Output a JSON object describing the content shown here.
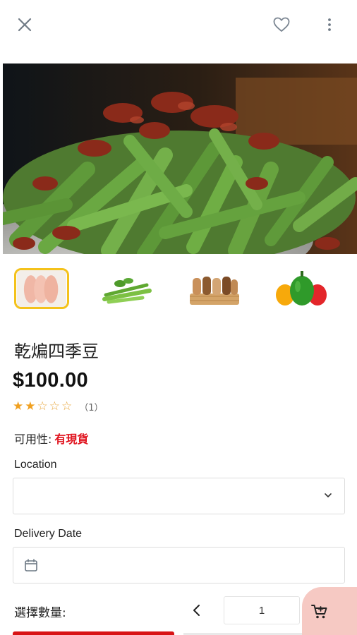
{
  "header": {
    "close_icon": "close-icon",
    "favorite_icon": "heart-outline-icon",
    "more_icon": "more-vertical-icon"
  },
  "gallery": {
    "main_image": "stir-fried green beans with dried chili",
    "thumbnails": [
      {
        "name": "chicken breast",
        "selected": true
      },
      {
        "name": "celery",
        "selected": false
      },
      {
        "name": "bread basket",
        "selected": false
      },
      {
        "name": "bell peppers",
        "selected": false
      }
    ]
  },
  "product": {
    "title": "乾煸四季豆",
    "price": "$100.00",
    "rating": 2,
    "rating_max": 5,
    "rating_count": "（1）",
    "availability_label": "可用性:",
    "availability_value": "有現貨"
  },
  "form": {
    "location_label": "Location",
    "location_value": "",
    "delivery_date_label": "Delivery Date",
    "delivery_date_value": "",
    "quantity_label": "選擇數量:",
    "quantity_value": "1"
  },
  "colors": {
    "accent_red": "#e0121d",
    "star": "#f0a020",
    "thumb_selected_border": "#f4c21b",
    "cart_bg": "#f6c9c3"
  }
}
